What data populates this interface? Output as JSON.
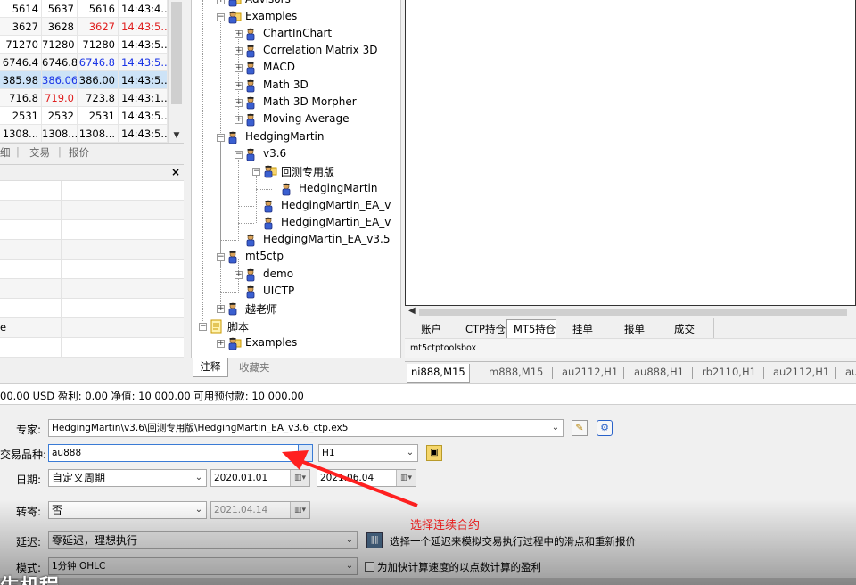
{
  "market_watch": {
    "rows": [
      {
        "bid": "5614",
        "ask": "5637",
        "last": "5616",
        "time": "14:43:4...",
        "last_color": "",
        "time_color": ""
      },
      {
        "bid": "3627",
        "ask": "3628",
        "last": "3627",
        "time": "14:43:5...",
        "last_color": "red",
        "time_color": "red"
      },
      {
        "bid": "71270",
        "ask": "71280",
        "last": "71280",
        "time": "14:43:5...",
        "last_color": "",
        "time_color": ""
      },
      {
        "bid": "6746.4",
        "ask": "6746.8",
        "last": "6746.8",
        "time": "14:43:5...",
        "last_color": "blue",
        "time_color": "blue"
      },
      {
        "bid": "385.98",
        "ask": "386.06",
        "last": "386.00",
        "time": "14:43:5...",
        "last_color": "",
        "time_color": ""
      },
      {
        "bid": "716.8",
        "ask": "719.0",
        "last": "723.8",
        "time": "14:43:1...",
        "last_color": "",
        "time_color": ""
      },
      {
        "bid": "2531",
        "ask": "2532",
        "last": "2531",
        "time": "14:43:5...",
        "last_color": "",
        "time_color": ""
      },
      {
        "bid": "1308...",
        "ask": "1308...",
        "last": "1308...",
        "time": "14:43:5...",
        "last_color": "",
        "time_color": ""
      }
    ],
    "tabs": [
      "细",
      "交易",
      "报价"
    ]
  },
  "data_window": {
    "close_label": "×",
    "last_label": "e"
  },
  "navigator": {
    "items": [
      {
        "label": "Advisors"
      },
      {
        "label": "Examples"
      },
      {
        "label": "ChartInChart"
      },
      {
        "label": "Correlation Matrix 3D"
      },
      {
        "label": "MACD"
      },
      {
        "label": "Math 3D"
      },
      {
        "label": "Math 3D Morpher"
      },
      {
        "label": "Moving Average"
      },
      {
        "label": "HedgingMartin"
      },
      {
        "label": "v3.6"
      },
      {
        "label": "回测专用版"
      },
      {
        "label": "HedgingMartin_"
      },
      {
        "label": "HedgingMartin_EA_v"
      },
      {
        "label": "HedgingMartin_EA_v"
      },
      {
        "label": "HedgingMartin_EA_v3.5"
      },
      {
        "label": "mt5ctp"
      },
      {
        "label": "demo"
      },
      {
        "label": "UICTP"
      },
      {
        "label": "越老师"
      },
      {
        "label": "脚本"
      },
      {
        "label": "Examples"
      }
    ],
    "tabs": [
      "注释",
      "收藏夹"
    ]
  },
  "toolbox": {
    "tabs": [
      "账户",
      "CTP持仓",
      "MT5持仓",
      "挂单",
      "报单",
      "成交"
    ],
    "caption": "mt5ctptoolsbox"
  },
  "chart_tabs": [
    "ni888,M15",
    "m888,M15",
    "au2112,H1",
    "au888,H1",
    "rb2110,H1",
    "au2112,H1",
    "au"
  ],
  "status_text": "00.00 USD  盈利: 0.00  净值: 10 000.00  可用预付款: 10 000.00",
  "tester": {
    "expert_label": "专家:",
    "expert_value": "HedgingMartin\\v3.6\\回测专用版\\HedgingMartin_EA_v3.6_ctp.ex5",
    "symbol_label": "交易品种:",
    "symbol_value": "au888",
    "period_value": "H1",
    "date_label": "日期:",
    "date_mode": "自定义周期",
    "date_from": "2020.01.01",
    "date_to": "2021.06.04",
    "forward_label": "转寄:",
    "forward_value": "否",
    "forward_date": "2021.04.14",
    "delay_label": "延迟:",
    "delay_value": "零延迟，理想执行",
    "delay_note": "选择一个延迟来模拟交易执行过程中的滑点和重新报价",
    "model_label": "模式:",
    "model_value": "1分钟 OHLC",
    "profit_note": "为加快计算速度的以点数计算的盈利",
    "annotation": "选择连续合约",
    "bottom_text": "生机程"
  },
  "colors": {
    "price_up": "#1a34e6",
    "price_down": "#e02020",
    "selection": "#cde3f7",
    "annotation": "#ff2020"
  }
}
